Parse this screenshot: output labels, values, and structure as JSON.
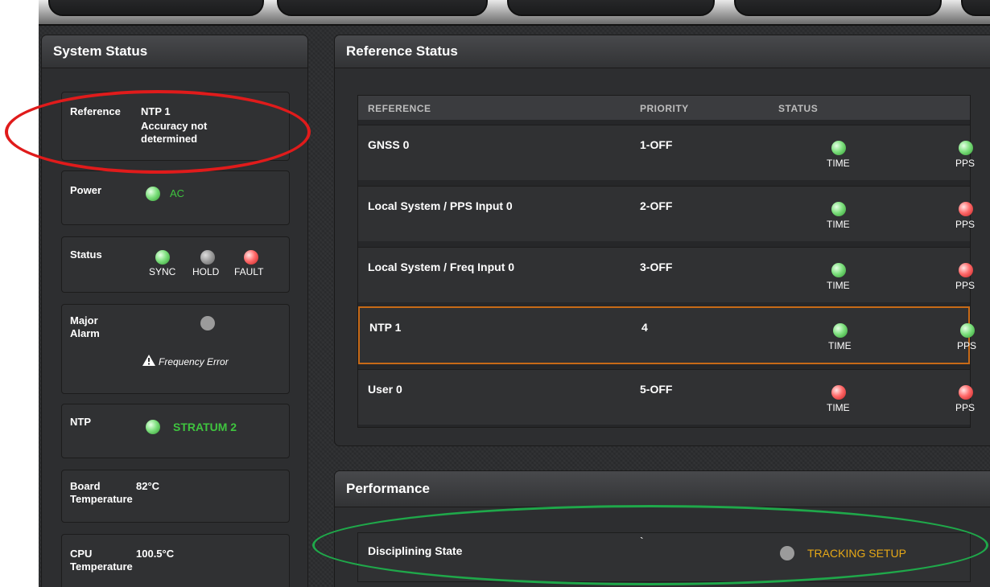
{
  "colors": {
    "green_text": "#3fc43f",
    "amber_text": "#e6a817",
    "selected_border": "#c76a17",
    "annotation_red": "#e01b1b",
    "annotation_green": "#1fa84a"
  },
  "system_status": {
    "title": "System Status",
    "reference": {
      "label": "Reference",
      "value": "NTP 1",
      "detail_line1": "Accuracy not",
      "detail_line2": "determined"
    },
    "power": {
      "label": "Power",
      "led": "green",
      "value": "AC"
    },
    "status": {
      "label": "Status",
      "leds": [
        {
          "color": "green",
          "label": "SYNC"
        },
        {
          "color": "grey",
          "label": "HOLD"
        },
        {
          "color": "red",
          "label": "FAULT"
        }
      ]
    },
    "major_alarm": {
      "label_line1": "Major",
      "label_line2": "Alarm",
      "led": "grey",
      "warning_icon": "warning-triangle-icon",
      "message": "Frequency Error"
    },
    "ntp": {
      "label": "NTP",
      "led": "green",
      "value": "STRATUM 2"
    },
    "board_temp": {
      "label_line1": "Board",
      "label_line2": "Temperature",
      "value": "82°C"
    },
    "cpu_temp": {
      "label_line1": "CPU",
      "label_line2": "Temperature",
      "value": "100.5°C"
    }
  },
  "reference_status": {
    "title": "Reference Status",
    "columns": {
      "reference": "REFERENCE",
      "priority": "PRIORITY",
      "status": "STATUS"
    },
    "rows": [
      {
        "name": "GNSS 0",
        "priority": "1-OFF",
        "time_led": "green",
        "time_label": "TIME",
        "pps_led": "green",
        "pps_label": "PPS",
        "selected": false
      },
      {
        "name": "Local System / PPS Input 0",
        "priority": "2-OFF",
        "time_led": "green",
        "time_label": "TIME",
        "pps_led": "red",
        "pps_label": "PPS",
        "selected": false
      },
      {
        "name": "Local System / Freq Input 0",
        "priority": "3-OFF",
        "time_led": "green",
        "time_label": "TIME",
        "pps_led": "red",
        "pps_label": "PPS",
        "selected": false
      },
      {
        "name": "NTP 1",
        "priority": "4",
        "time_led": "green",
        "time_label": "TIME",
        "pps_led": "green",
        "pps_label": "PPS",
        "selected": true
      },
      {
        "name": "User 0",
        "priority": "5-OFF",
        "time_led": "red",
        "time_label": "TIME",
        "pps_led": "red",
        "pps_label": "PPS",
        "selected": false
      }
    ]
  },
  "performance": {
    "title": "Performance",
    "disciplining_state": {
      "label": "Disciplining State",
      "mark": "`",
      "led": "grey",
      "value": "TRACKING SETUP"
    }
  }
}
